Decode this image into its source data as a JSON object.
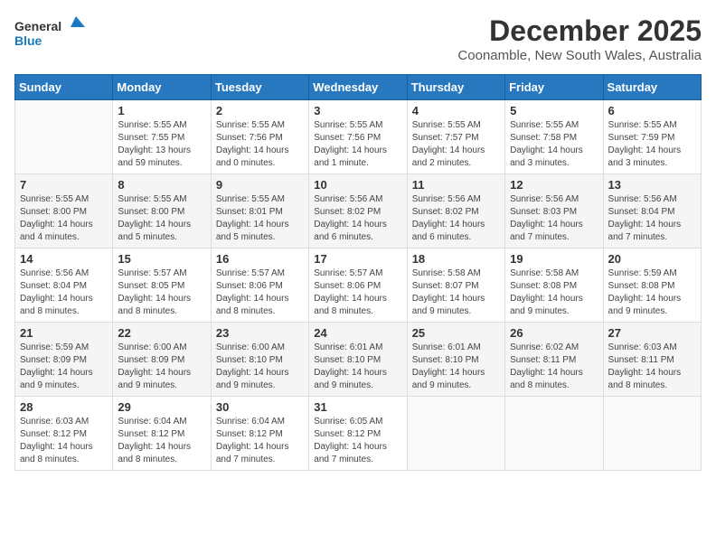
{
  "logo": {
    "line1": "General",
    "line2": "Blue"
  },
  "title": "December 2025",
  "subtitle": "Coonamble, New South Wales, Australia",
  "days_of_week": [
    "Sunday",
    "Monday",
    "Tuesday",
    "Wednesday",
    "Thursday",
    "Friday",
    "Saturday"
  ],
  "weeks": [
    [
      {
        "day": "",
        "info": ""
      },
      {
        "day": "1",
        "info": "Sunrise: 5:55 AM\nSunset: 7:55 PM\nDaylight: 13 hours\nand 59 minutes."
      },
      {
        "day": "2",
        "info": "Sunrise: 5:55 AM\nSunset: 7:56 PM\nDaylight: 14 hours\nand 0 minutes."
      },
      {
        "day": "3",
        "info": "Sunrise: 5:55 AM\nSunset: 7:56 PM\nDaylight: 14 hours\nand 1 minute."
      },
      {
        "day": "4",
        "info": "Sunrise: 5:55 AM\nSunset: 7:57 PM\nDaylight: 14 hours\nand 2 minutes."
      },
      {
        "day": "5",
        "info": "Sunrise: 5:55 AM\nSunset: 7:58 PM\nDaylight: 14 hours\nand 3 minutes."
      },
      {
        "day": "6",
        "info": "Sunrise: 5:55 AM\nSunset: 7:59 PM\nDaylight: 14 hours\nand 3 minutes."
      }
    ],
    [
      {
        "day": "7",
        "info": "Sunrise: 5:55 AM\nSunset: 8:00 PM\nDaylight: 14 hours\nand 4 minutes."
      },
      {
        "day": "8",
        "info": "Sunrise: 5:55 AM\nSunset: 8:00 PM\nDaylight: 14 hours\nand 5 minutes."
      },
      {
        "day": "9",
        "info": "Sunrise: 5:55 AM\nSunset: 8:01 PM\nDaylight: 14 hours\nand 5 minutes."
      },
      {
        "day": "10",
        "info": "Sunrise: 5:56 AM\nSunset: 8:02 PM\nDaylight: 14 hours\nand 6 minutes."
      },
      {
        "day": "11",
        "info": "Sunrise: 5:56 AM\nSunset: 8:02 PM\nDaylight: 14 hours\nand 6 minutes."
      },
      {
        "day": "12",
        "info": "Sunrise: 5:56 AM\nSunset: 8:03 PM\nDaylight: 14 hours\nand 7 minutes."
      },
      {
        "day": "13",
        "info": "Sunrise: 5:56 AM\nSunset: 8:04 PM\nDaylight: 14 hours\nand 7 minutes."
      }
    ],
    [
      {
        "day": "14",
        "info": "Sunrise: 5:56 AM\nSunset: 8:04 PM\nDaylight: 14 hours\nand 8 minutes."
      },
      {
        "day": "15",
        "info": "Sunrise: 5:57 AM\nSunset: 8:05 PM\nDaylight: 14 hours\nand 8 minutes."
      },
      {
        "day": "16",
        "info": "Sunrise: 5:57 AM\nSunset: 8:06 PM\nDaylight: 14 hours\nand 8 minutes."
      },
      {
        "day": "17",
        "info": "Sunrise: 5:57 AM\nSunset: 8:06 PM\nDaylight: 14 hours\nand 8 minutes."
      },
      {
        "day": "18",
        "info": "Sunrise: 5:58 AM\nSunset: 8:07 PM\nDaylight: 14 hours\nand 9 minutes."
      },
      {
        "day": "19",
        "info": "Sunrise: 5:58 AM\nSunset: 8:08 PM\nDaylight: 14 hours\nand 9 minutes."
      },
      {
        "day": "20",
        "info": "Sunrise: 5:59 AM\nSunset: 8:08 PM\nDaylight: 14 hours\nand 9 minutes."
      }
    ],
    [
      {
        "day": "21",
        "info": "Sunrise: 5:59 AM\nSunset: 8:09 PM\nDaylight: 14 hours\nand 9 minutes."
      },
      {
        "day": "22",
        "info": "Sunrise: 6:00 AM\nSunset: 8:09 PM\nDaylight: 14 hours\nand 9 minutes."
      },
      {
        "day": "23",
        "info": "Sunrise: 6:00 AM\nSunset: 8:10 PM\nDaylight: 14 hours\nand 9 minutes."
      },
      {
        "day": "24",
        "info": "Sunrise: 6:01 AM\nSunset: 8:10 PM\nDaylight: 14 hours\nand 9 minutes."
      },
      {
        "day": "25",
        "info": "Sunrise: 6:01 AM\nSunset: 8:10 PM\nDaylight: 14 hours\nand 9 minutes."
      },
      {
        "day": "26",
        "info": "Sunrise: 6:02 AM\nSunset: 8:11 PM\nDaylight: 14 hours\nand 8 minutes."
      },
      {
        "day": "27",
        "info": "Sunrise: 6:03 AM\nSunset: 8:11 PM\nDaylight: 14 hours\nand 8 minutes."
      }
    ],
    [
      {
        "day": "28",
        "info": "Sunrise: 6:03 AM\nSunset: 8:12 PM\nDaylight: 14 hours\nand 8 minutes."
      },
      {
        "day": "29",
        "info": "Sunrise: 6:04 AM\nSunset: 8:12 PM\nDaylight: 14 hours\nand 8 minutes."
      },
      {
        "day": "30",
        "info": "Sunrise: 6:04 AM\nSunset: 8:12 PM\nDaylight: 14 hours\nand 7 minutes."
      },
      {
        "day": "31",
        "info": "Sunrise: 6:05 AM\nSunset: 8:12 PM\nDaylight: 14 hours\nand 7 minutes."
      },
      {
        "day": "",
        "info": ""
      },
      {
        "day": "",
        "info": ""
      },
      {
        "day": "",
        "info": ""
      }
    ]
  ]
}
